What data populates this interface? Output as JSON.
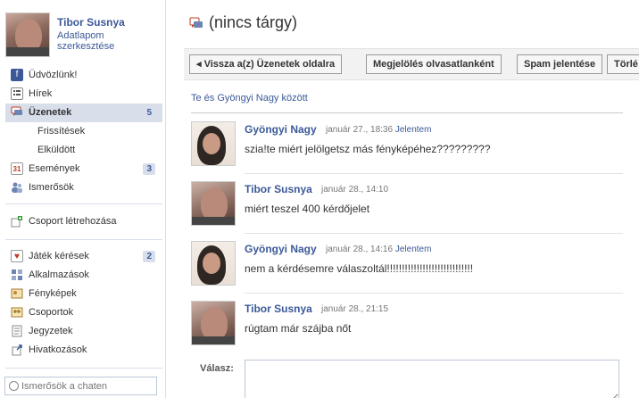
{
  "profile": {
    "name": "Tibor Susnya",
    "edit": "Adatlapom szerkesztése"
  },
  "nav": [
    {
      "label": "Üdvözlünk!",
      "icon": "facebook-icon",
      "color": "#3b5998"
    },
    {
      "label": "Hírek",
      "icon": "newsfeed-icon",
      "color": "#6d84b4"
    },
    {
      "label": "Üzenetek",
      "icon": "messages-icon",
      "color": "#6d84b4",
      "count": "5",
      "active": true
    },
    {
      "label": "Frissítések",
      "sub": true
    },
    {
      "label": "Elküldött",
      "sub": true
    },
    {
      "label": "Események",
      "icon": "calendar-icon",
      "color": "#c23b22",
      "count": "3"
    },
    {
      "label": "Ismerősök",
      "icon": "friends-icon",
      "color": "#6d84b4"
    }
  ],
  "create_group": {
    "label": "Csoport létrehozása"
  },
  "apps": [
    {
      "label": "Játék kérések",
      "icon": "game-icon",
      "count": "2"
    },
    {
      "label": "Alkalmazások",
      "icon": "apps-icon"
    },
    {
      "label": "Fényképek",
      "icon": "photos-icon"
    },
    {
      "label": "Csoportok",
      "icon": "groups-icon"
    },
    {
      "label": "Jegyzetek",
      "icon": "notes-icon"
    },
    {
      "label": "Hivatkozások",
      "icon": "links-icon"
    }
  ],
  "chat_search": {
    "placeholder": "Ismerősök a chaten"
  },
  "thread": {
    "title": "(nincs tárgy)",
    "back_button": "◂ Vissza a(z) Üzenetek oldalra",
    "mark_unread_button": "Megjelölés olvasatlanként",
    "spam_button": "Spam jelentése",
    "delete_button": "Törlé",
    "between": "Te és Gyöngyi Nagy között",
    "messages": [
      {
        "author": "Gyöngyi Nagy",
        "time": "január 27., 18:36",
        "report": "Jelentem",
        "text": "szia!te miért jelölgetsz más fényképéhez?????????",
        "avatar": "g"
      },
      {
        "author": "Tibor Susnya",
        "time": "január 28., 14:10",
        "report": "",
        "text": "miért teszel 400 kérdőjelet",
        "avatar": "t"
      },
      {
        "author": "Gyöngyi Nagy",
        "time": "január 28., 14:16",
        "report": "Jelentem",
        "text": "nem a kérdésemre válaszoltál!!!!!!!!!!!!!!!!!!!!!!!!!!!!!",
        "avatar": "g"
      },
      {
        "author": "Tibor Susnya",
        "time": "január 28., 21:15",
        "report": "",
        "text": "rúgtam már szájba nőt",
        "avatar": "t"
      }
    ],
    "reply_label": "Válasz:"
  },
  "colors": {
    "link": "#3b5998",
    "sidebar_active": "#d8dfea"
  }
}
